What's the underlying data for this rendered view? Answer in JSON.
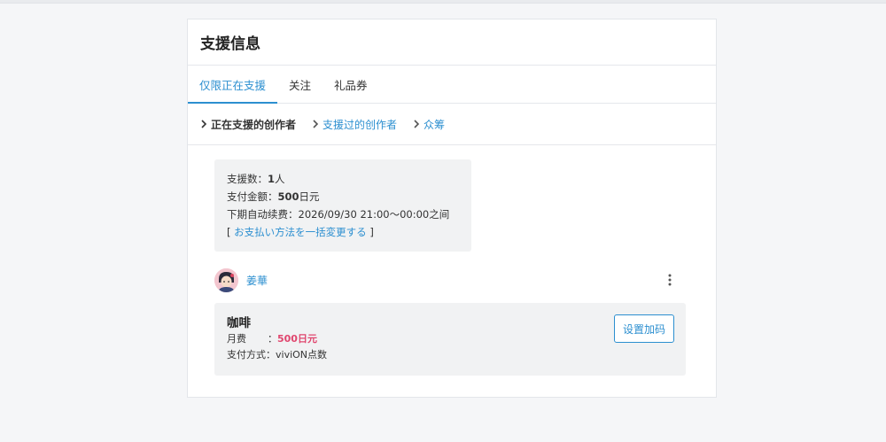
{
  "page": {
    "title": "支援信息"
  },
  "tabs": [
    {
      "label": "仅限正在支援",
      "active": true
    },
    {
      "label": "关注",
      "active": false
    },
    {
      "label": "礼品券",
      "active": false
    }
  ],
  "subnav": [
    {
      "label": "正在支援的创作者",
      "current": true
    },
    {
      "label": "支援过的创作者",
      "current": false
    },
    {
      "label": "众筹",
      "current": false
    }
  ],
  "summary": {
    "supporters_label": "支援数：",
    "supporters_value": "1",
    "supporters_unit": "人",
    "amount_label": "支付金额：",
    "amount_value": "500",
    "amount_unit": "日元",
    "renewal_label": "下期自动续费：",
    "renewal_value": "2026/09/30 21:00～00:00之间",
    "bracket_open": "[",
    "payment_link": "お支払い方法を一括変更する",
    "bracket_close": "]"
  },
  "creator": {
    "name": "姜華",
    "menu_icon": "kebab-icon"
  },
  "plan": {
    "name": "咖啡",
    "fee_label": "月费",
    "fee_colon": "：",
    "fee_value": "500日元",
    "method_label": "支付方式：",
    "method_value": "viviON点数",
    "upgrade_label": "设置加码"
  },
  "colors": {
    "accent": "#2c8fd0",
    "price": "#e0466e",
    "background": "#f5f6f8",
    "panel": "#f1f2f3"
  }
}
